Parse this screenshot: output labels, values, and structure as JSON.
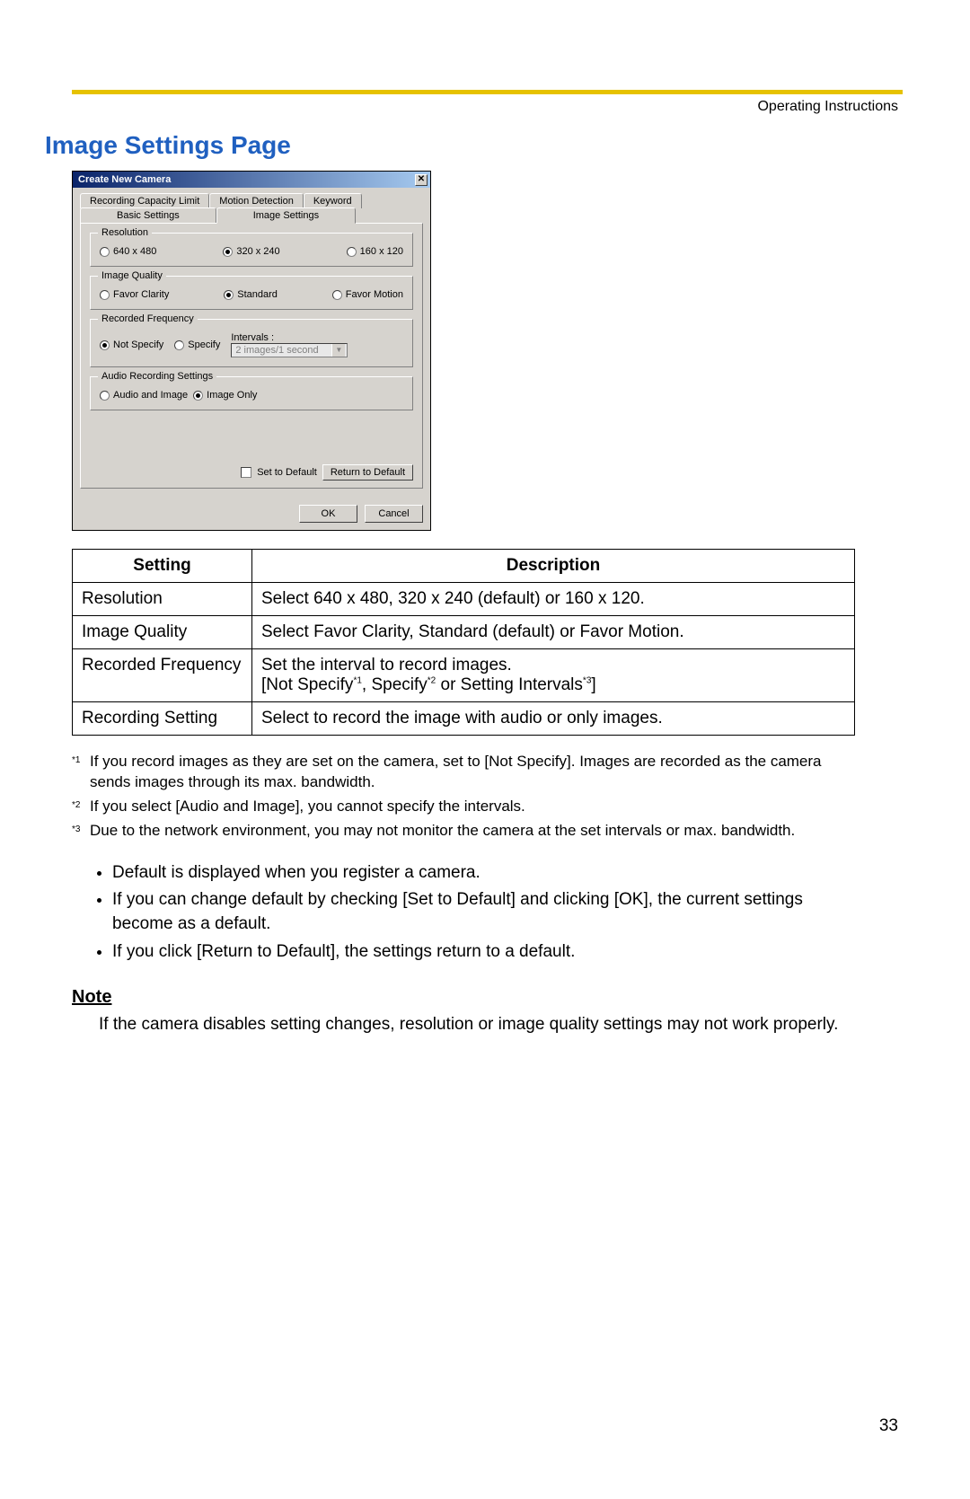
{
  "header": {
    "right": "Operating Instructions"
  },
  "title": "Image Settings Page",
  "dialog": {
    "title": "Create New Camera",
    "close_glyph": "✕",
    "tabs_top": [
      "Recording Capacity Limit",
      "Motion Detection",
      "Keyword"
    ],
    "tabs_bottom": [
      "Basic Settings",
      "Image Settings"
    ],
    "active_tab": "Image Settings",
    "resolution": {
      "legend": "Resolution",
      "options": [
        "640 x 480",
        "320 x 240",
        "160 x 120"
      ],
      "selected": "320 x 240"
    },
    "quality": {
      "legend": "Image Quality",
      "options": [
        "Favor Clarity",
        "Standard",
        "Favor Motion"
      ],
      "selected": "Standard"
    },
    "frequency": {
      "legend": "Recorded Frequency",
      "options": [
        "Not Specify",
        "Specify"
      ],
      "selected": "Not Specify",
      "intervals_label": "Intervals :",
      "intervals_value": "2 images/1 second"
    },
    "audio": {
      "legend": "Audio Recording Settings",
      "options": [
        "Audio and Image",
        "Image Only"
      ],
      "selected": "Image Only"
    },
    "set_default_label": "Set to Default",
    "return_default_label": "Return to Default",
    "ok_label": "OK",
    "cancel_label": "Cancel"
  },
  "table": {
    "head": {
      "setting": "Setting",
      "description": "Description"
    },
    "rows": [
      {
        "setting": "Resolution",
        "description": "Select 640 x 480, 320 x 240 (default) or 160 x 120."
      },
      {
        "setting": "Image Quality",
        "description": "Select Favor Clarity, Standard (default) or Favor Motion."
      },
      {
        "setting": "Recorded Frequency",
        "description_line1": "Set the interval to record images.",
        "description_line2_pre": "[Not Specify",
        "description_line2_mid1": ", Specify",
        "description_line2_mid2": " or Setting Intervals",
        "description_line2_post": "]"
      },
      {
        "setting": "Recording Setting",
        "description": "Select to record the image with audio or only images."
      }
    ]
  },
  "footnotes": [
    {
      "mark": "*1",
      "text": "If you record images as they are set on the camera, set to [Not Specify]. Images are recorded as the camera sends images through its max. bandwidth."
    },
    {
      "mark": "*2",
      "text": "If you select [Audio and Image], you cannot specify the intervals."
    },
    {
      "mark": "*3",
      "text": "Due to the network environment, you may not monitor the camera at the set intervals or max. bandwidth."
    }
  ],
  "bullets": [
    "Default is displayed when you register a camera.",
    "If you can change default by checking [Set to Default] and clicking [OK], the current settings become as a default.",
    "If you click [Return to Default], the settings return to a default."
  ],
  "note": {
    "heading": "Note",
    "body": "If the camera disables setting changes, resolution or image quality settings may not work properly."
  },
  "page_number": "33",
  "sup": {
    "s1": "*1",
    "s2": "*2",
    "s3": "*3"
  }
}
